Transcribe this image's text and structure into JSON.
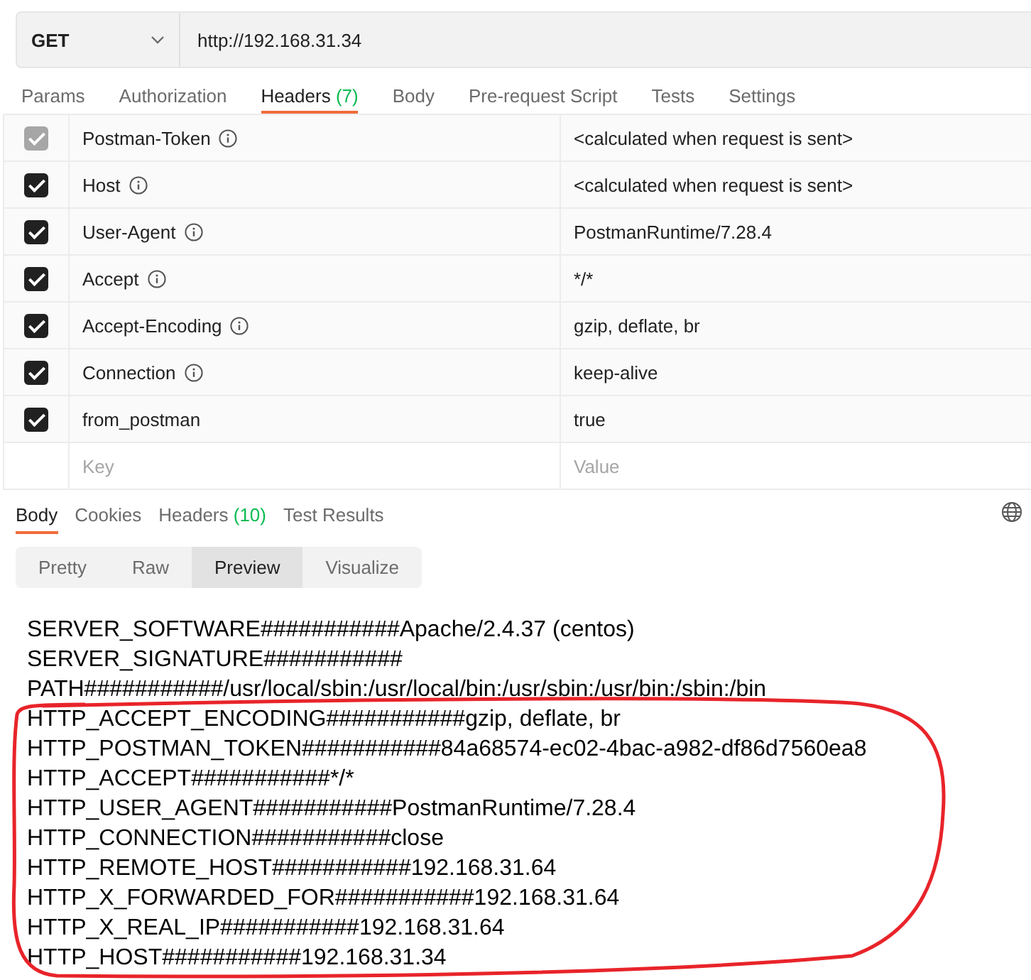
{
  "request": {
    "method": "GET",
    "url": "http://192.168.31.34"
  },
  "request_tabs": [
    {
      "label": "Params",
      "selected": false
    },
    {
      "label": "Authorization",
      "selected": false
    },
    {
      "label": "Headers",
      "count": "(7)",
      "selected": true
    },
    {
      "label": "Body",
      "selected": false
    },
    {
      "label": "Pre-request Script",
      "selected": false
    },
    {
      "label": "Tests",
      "selected": false
    },
    {
      "label": "Settings",
      "selected": false
    }
  ],
  "headers": [
    {
      "key": "Postman-Token",
      "value": "<calculated when request is sent>",
      "checked": true,
      "disabled": true,
      "info": true
    },
    {
      "key": "Host",
      "value": "<calculated when request is sent>",
      "checked": true,
      "disabled": false,
      "info": true
    },
    {
      "key": "User-Agent",
      "value": "PostmanRuntime/7.28.4",
      "checked": true,
      "disabled": false,
      "info": true
    },
    {
      "key": "Accept",
      "value": "*/*",
      "checked": true,
      "disabled": false,
      "info": true
    },
    {
      "key": "Accept-Encoding",
      "value": "gzip, deflate, br",
      "checked": true,
      "disabled": false,
      "info": true
    },
    {
      "key": "Connection",
      "value": "keep-alive",
      "checked": true,
      "disabled": false,
      "info": true
    },
    {
      "key": "from_postman",
      "value": "true",
      "checked": true,
      "disabled": false,
      "info": false
    }
  ],
  "new_header": {
    "key_placeholder": "Key",
    "value_placeholder": "Value"
  },
  "response_tabs": [
    {
      "label": "Body",
      "selected": true
    },
    {
      "label": "Cookies",
      "selected": false
    },
    {
      "label": "Headers",
      "count": "(10)",
      "selected": false
    },
    {
      "label": "Test Results",
      "selected": false
    }
  ],
  "view_modes": [
    {
      "label": "Pretty",
      "selected": false
    },
    {
      "label": "Raw",
      "selected": false
    },
    {
      "label": "Preview",
      "selected": true
    },
    {
      "label": "Visualize",
      "selected": false
    }
  ],
  "body_lines": [
    "SERVER_SOFTWARE###########Apache/2.4.37 (centos)",
    "SERVER_SIGNATURE###########",
    "PATH###########/usr/local/sbin:/usr/local/bin:/usr/sbin:/usr/bin:/sbin:/bin",
    "HTTP_ACCEPT_ENCODING###########gzip, deflate, br",
    "HTTP_POSTMAN_TOKEN###########84a68574-ec02-4bac-a982-df86d7560ea8",
    "HTTP_ACCEPT###########*/*",
    "HTTP_USER_AGENT###########PostmanRuntime/7.28.4",
    "HTTP_CONNECTION###########close",
    "HTTP_REMOTE_HOST###########192.168.31.64",
    "HTTP_X_FORWARDED_FOR###########192.168.31.64",
    "HTTP_X_REAL_IP###########192.168.31.64",
    "HTTP_HOST###########192.168.31.34"
  ]
}
